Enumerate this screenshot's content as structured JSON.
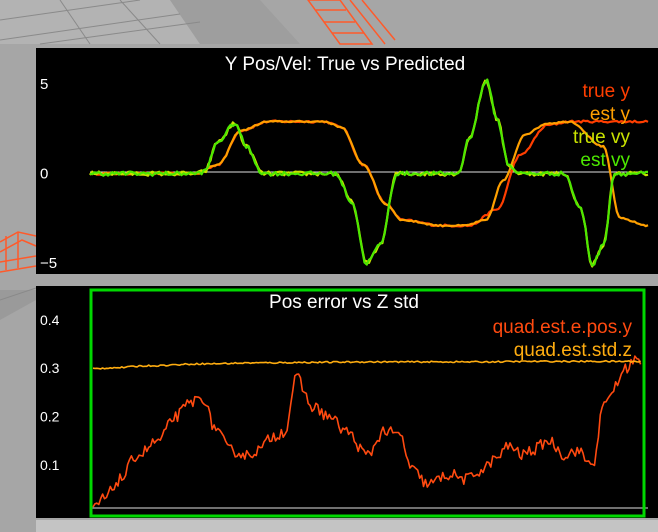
{
  "colors": {
    "plot_bg": "#000000",
    "scene_bg": "#a7a7a7",
    "highlight": "#00d800",
    "text": "#ffffff",
    "true_y": "#ff3e00",
    "est_y": "#ffa000",
    "true_vy": "#c9e200",
    "est_vy": "#4de800",
    "pos_err": "#ff4a10",
    "std_z": "#ffad10"
  },
  "chart_data": [
    {
      "type": "line",
      "title": "Y Pos/Vel: True vs Predicted",
      "ylim": [
        -5.6,
        7.0
      ],
      "xlim": [
        0,
        100
      ],
      "yticks": [
        {
          "value": 5,
          "label": "5"
        },
        {
          "value": 0,
          "label": "0"
        },
        {
          "value": -5,
          "label": "−5"
        }
      ],
      "legend_position": "top-right",
      "series": [
        {
          "name": "true y",
          "color_key": "true_y",
          "x": [
            0,
            19,
            23,
            27,
            32,
            42,
            45,
            49,
            53,
            56,
            63,
            68,
            73,
            77,
            82,
            86,
            95,
            100
          ],
          "y": [
            0,
            0,
            0.5,
            2.4,
            2.9,
            2.9,
            2.6,
            0.5,
            -1.7,
            -2.6,
            -2.9,
            -2.9,
            -2.0,
            1.0,
            2.7,
            2.9,
            2.9,
            2.9
          ]
        },
        {
          "name": "est y",
          "color_key": "est_y",
          "x": [
            0,
            19,
            23,
            27,
            32,
            42,
            45,
            49,
            53,
            56,
            63,
            67,
            71,
            74,
            78,
            82,
            86,
            92,
            95,
            100
          ],
          "y": [
            0,
            0,
            0.5,
            2.4,
            2.9,
            2.9,
            2.6,
            0.5,
            -1.7,
            -2.6,
            -2.9,
            -2.9,
            -2.6,
            -0.4,
            2.2,
            2.8,
            2.9,
            1.5,
            -2.5,
            -2.9
          ]
        },
        {
          "name": "true vy",
          "color_key": "true_vy",
          "x": [
            0,
            19,
            20.5,
            23,
            26,
            28,
            31,
            44,
            47,
            49.5,
            52,
            55,
            66,
            68,
            71,
            73,
            75,
            77,
            80,
            85,
            88,
            90,
            92,
            94,
            96,
            100
          ],
          "y": [
            0,
            0,
            0.1,
            1.8,
            2.8,
            1.5,
            0,
            0,
            -1.6,
            -5.0,
            -4.0,
            0,
            0,
            2.0,
            5.2,
            3.0,
            0.5,
            0,
            0,
            0,
            -2.0,
            -5.1,
            -4.0,
            0,
            0,
            0
          ]
        },
        {
          "name": "est vy",
          "color_key": "est_vy",
          "x": [
            0,
            19,
            20.5,
            23,
            26,
            28,
            31,
            44,
            47,
            49.5,
            52,
            55,
            66,
            68,
            71,
            73,
            75,
            77,
            80,
            85,
            88,
            90,
            92,
            94,
            96,
            100
          ],
          "y": [
            0,
            0,
            0.1,
            1.8,
            2.8,
            1.5,
            0,
            0,
            -1.6,
            -5.0,
            -4.0,
            0,
            0,
            2.0,
            5.2,
            3.0,
            0.5,
            0,
            0,
            0,
            -2.0,
            -5.1,
            -4.0,
            0,
            0,
            0
          ]
        }
      ]
    },
    {
      "type": "line",
      "title": "Pos error vs Z std",
      "ylim": [
        -0.01,
        0.47
      ],
      "xlim": [
        0,
        100
      ],
      "yticks": [
        {
          "value": 0.4,
          "label": "0.4"
        },
        {
          "value": 0.3,
          "label": "0.3"
        },
        {
          "value": 0.2,
          "label": "0.2"
        },
        {
          "value": 0.1,
          "label": "0.1"
        }
      ],
      "legend_position": "top-right",
      "series": [
        {
          "name": "quad.est.e.pos.y",
          "color_key": "pos_err",
          "x": [
            0,
            2,
            5,
            8,
            12,
            15,
            18,
            20,
            22,
            25,
            28,
            30,
            33,
            35,
            37,
            40,
            43,
            46,
            50,
            53,
            56,
            58,
            61,
            65,
            68,
            71,
            73,
            76,
            78,
            80,
            83,
            86,
            88,
            91,
            93,
            95,
            97,
            99,
            100
          ],
          "y": [
            0.01,
            0.03,
            0.07,
            0.12,
            0.15,
            0.2,
            0.23,
            0.24,
            0.18,
            0.13,
            0.12,
            0.13,
            0.16,
            0.17,
            0.28,
            0.22,
            0.2,
            0.17,
            0.12,
            0.17,
            0.16,
            0.09,
            0.06,
            0.08,
            0.07,
            0.09,
            0.11,
            0.14,
            0.12,
            0.13,
            0.15,
            0.12,
            0.13,
            0.1,
            0.22,
            0.26,
            0.3,
            0.32,
            0.3
          ]
        },
        {
          "name": "quad.est.std.z",
          "color_key": "std_z",
          "x": [
            0,
            4,
            10,
            20,
            30,
            40,
            50,
            60,
            70,
            80,
            90,
            95,
            100
          ],
          "y": [
            0.299,
            0.301,
            0.305,
            0.309,
            0.311,
            0.312,
            0.313,
            0.313,
            0.313,
            0.314,
            0.314,
            0.314,
            0.314
          ]
        }
      ]
    }
  ]
}
